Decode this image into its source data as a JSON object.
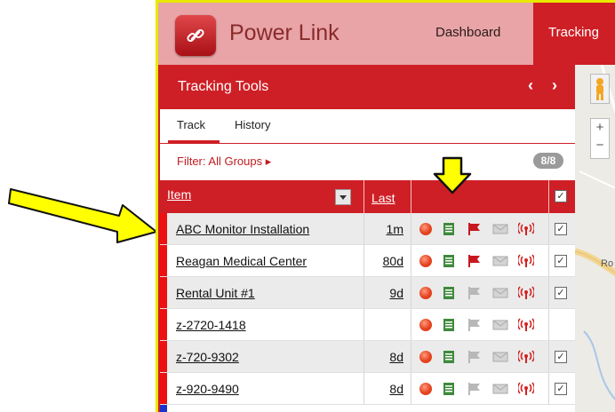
{
  "app": {
    "brand": "Power Link",
    "nav": {
      "dashboard": "Dashboard",
      "tracking": "Tracking"
    }
  },
  "panel": {
    "title": "Tracking Tools",
    "nav_arrows": "‹ ›",
    "tabs": [
      {
        "label": "Track"
      },
      {
        "label": "History"
      }
    ],
    "filter_label": "Filter: All Groups ▸",
    "count_badge": "8/8",
    "columns": {
      "item": "Item",
      "last": "Last"
    },
    "header_check": "✓"
  },
  "rows": [
    {
      "name": "ABC Monitor Installation",
      "last": "1m",
      "flag": "red",
      "checked": true
    },
    {
      "name": "Reagan Medical Center",
      "last": "80d",
      "flag": "red",
      "checked": true
    },
    {
      "name": "Rental Unit #1",
      "last": "9d",
      "flag": "gray",
      "checked": true
    },
    {
      "name": "z-2720-1418",
      "last": "",
      "flag": "gray",
      "checked": false
    },
    {
      "name": "z-720-9302",
      "last": "8d",
      "flag": "gray",
      "checked": true
    },
    {
      "name": "z-920-9490",
      "last": "8d",
      "flag": "gray",
      "checked": true
    }
  ],
  "map": {
    "road_label": "Ro"
  },
  "colors": {
    "brand_red": "#cf1f26",
    "annotation_yellow": "#ffff00",
    "status_bar": "#ee1111"
  },
  "icons": [
    "link-icon",
    "status-dot-icon",
    "notes-icon",
    "flag-icon",
    "mail-icon",
    "signal-icon",
    "pegman-icon"
  ]
}
